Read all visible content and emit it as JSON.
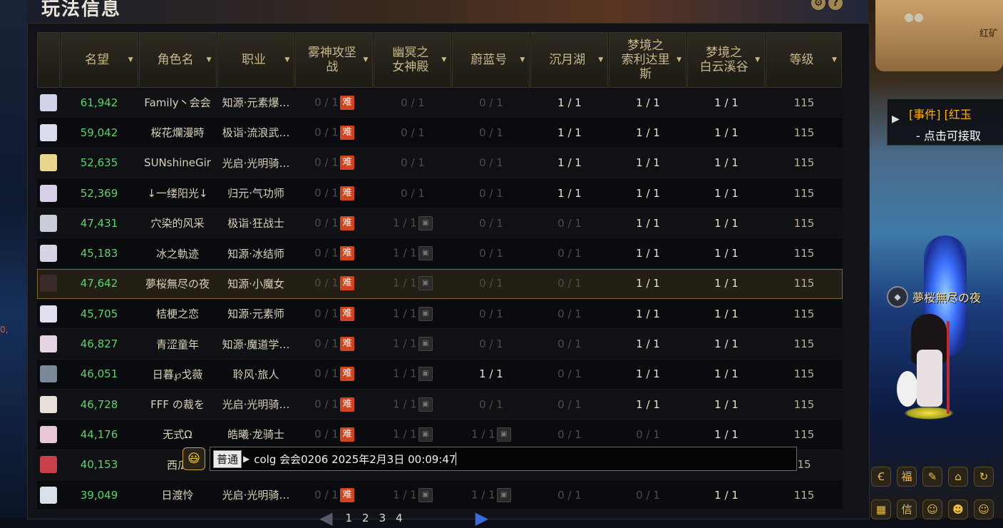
{
  "window": {
    "title": "玩法信息"
  },
  "top_icons": [
    {
      "name": "gear-icon",
      "glyph": "⚙"
    },
    {
      "name": "help-icon",
      "glyph": "?"
    }
  ],
  "columns": [
    {
      "label": "",
      "sortable": false
    },
    {
      "label": "名望",
      "sortable": true
    },
    {
      "label": "角色名",
      "sortable": true
    },
    {
      "label": "职业",
      "sortable": true
    },
    {
      "label": "雾神攻坚\n战",
      "sortable": true
    },
    {
      "label": "幽冥之\n女神殿",
      "sortable": true
    },
    {
      "label": "蔚蓝号",
      "sortable": true
    },
    {
      "label": "沉月湖",
      "sortable": true
    },
    {
      "label": "梦境之\n索利达里\n斯",
      "sortable": true
    },
    {
      "label": "梦境之\n白云溪谷",
      "sortable": true
    },
    {
      "label": "等级",
      "sortable": true
    }
  ],
  "rows": [
    {
      "portrait": "#cfd4e8",
      "fame": "61,942",
      "name": "Family丶会会",
      "class": "知源·元素爆…",
      "c4": "0 / 1",
      "c4_hard": true,
      "c5": "0 / 1",
      "c5_lock": false,
      "c6": "0 / 1",
      "c6_lock": false,
      "c7": "1 / 1",
      "c8": "1 / 1",
      "c9": "1 / 1",
      "level": "115"
    },
    {
      "portrait": "#dcdcf0",
      "fame": "59,042",
      "name": "桜花爛漫時",
      "class": "极诣·流浪武…",
      "c4": "0 / 1",
      "c4_hard": true,
      "c5": "0 / 1",
      "c5_lock": false,
      "c6": "0 / 1",
      "c6_lock": false,
      "c7": "1 / 1",
      "c8": "1 / 1",
      "c9": "1 / 1",
      "level": "115"
    },
    {
      "portrait": "#e8d48a",
      "fame": "52,635",
      "name": "SUNshineGir",
      "class": "光启·光明骑…",
      "c4": "0 / 1",
      "c4_hard": true,
      "c5": "0 / 1",
      "c5_lock": false,
      "c6": "0 / 1",
      "c6_lock": false,
      "c7": "1 / 1",
      "c8": "1 / 1",
      "c9": "1 / 1",
      "level": "115"
    },
    {
      "portrait": "#d8d0e8",
      "fame": "52,369",
      "name": "↓一缕阳光↓",
      "class": "归元·气功师",
      "c4": "0 / 1",
      "c4_hard": true,
      "c5": "0 / 1",
      "c5_lock": false,
      "c6": "0 / 1",
      "c6_lock": false,
      "c7": "1 / 1",
      "c8": "1 / 1",
      "c9": "1 / 1",
      "level": "115"
    },
    {
      "portrait": "#c8ccd8",
      "fame": "47,431",
      "name": "穴染的风采",
      "class": "极诣·狂战士",
      "c4": "0 / 1",
      "c4_hard": true,
      "c5": "1 / 1",
      "c5_lock": true,
      "c6": "0 / 1",
      "c6_lock": false,
      "c7": "0 / 1",
      "c8": "1 / 1",
      "c9": "1 / 1",
      "level": "115"
    },
    {
      "portrait": "#d4d4e4",
      "fame": "45,183",
      "name": "冰之軌迹",
      "class": "知源·冰结师",
      "c4": "0 / 1",
      "c4_hard": true,
      "c5": "1 / 1",
      "c5_lock": true,
      "c6": "0 / 1",
      "c6_lock": false,
      "c7": "0 / 1",
      "c8": "1 / 1",
      "c9": "1 / 1",
      "level": "115"
    },
    {
      "portrait": "#3a2a2a",
      "fame": "47,642",
      "name": "夢桜無尽の夜",
      "class": "知源·小魔女",
      "c4": "0 / 1",
      "c4_hard": true,
      "c5": "1 / 1",
      "c5_lock": true,
      "c6": "0 / 1",
      "c6_lock": false,
      "c7": "0 / 1",
      "c8": "1 / 1",
      "c9": "1 / 1",
      "level": "115",
      "selected": true
    },
    {
      "portrait": "#e0e0f0",
      "fame": "45,705",
      "name": "桔梗之恋",
      "class": "知源·元素师",
      "c4": "0 / 1",
      "c4_hard": true,
      "c5": "1 / 1",
      "c5_lock": true,
      "c6": "0 / 1",
      "c6_lock": false,
      "c7": "0 / 1",
      "c8": "1 / 1",
      "c9": "1 / 1",
      "level": "115"
    },
    {
      "portrait": "#e4d4e4",
      "fame": "46,827",
      "name": "青涩童年",
      "class": "知源·魔道学…",
      "c4": "0 / 1",
      "c4_hard": true,
      "c5": "1 / 1",
      "c5_lock": true,
      "c6": "0 / 1",
      "c6_lock": false,
      "c7": "0 / 1",
      "c8": "1 / 1",
      "c9": "1 / 1",
      "level": "115"
    },
    {
      "portrait": "#7a8898",
      "fame": "46,051",
      "name": "日暮℘戈薇",
      "class": "聆风·旅人",
      "c4": "0 / 1",
      "c4_hard": true,
      "c5": "1 / 1",
      "c5_lock": true,
      "c6": "1 / 1",
      "c6_lock": false,
      "c7": "0 / 1",
      "c8": "1 / 1",
      "c9": "1 / 1",
      "level": "115"
    },
    {
      "portrait": "#e8e0d8",
      "fame": "46,728",
      "name": "FFF の裁を",
      "class": "光启·光明骑…",
      "c4": "0 / 1",
      "c4_hard": true,
      "c5": "1 / 1",
      "c5_lock": true,
      "c6": "0 / 1",
      "c6_lock": false,
      "c7": "0 / 1",
      "c8": "1 / 1",
      "c9": "1 / 1",
      "level": "115"
    },
    {
      "portrait": "#e8c8d8",
      "fame": "44,176",
      "name": "无式Ω",
      "class": "皓曦·龙骑士",
      "c4": "0 / 1",
      "c4_hard": true,
      "c5": "1 / 1",
      "c5_lock": true,
      "c6": "1 / 1",
      "c6_lock": true,
      "c7": "0 / 1",
      "c8": "0 / 1",
      "c9": "1 / 1",
      "level": "115"
    },
    {
      "portrait": "#c84048",
      "fame": "40,153",
      "name": "西瓜",
      "class": "",
      "c4": "",
      "c4_hard": false,
      "c5": "",
      "c5_lock": false,
      "c6": "",
      "c6_lock": false,
      "c7": "",
      "c8": "",
      "c9": "",
      "level": "15"
    },
    {
      "portrait": "#d8e0e8",
      "fame": "39,049",
      "name": "日渡怜",
      "class": "光启·光明骑…",
      "c4": "0 / 1",
      "c4_hard": true,
      "c5": "1 / 1",
      "c5_lock": true,
      "c6": "1 / 1",
      "c6_lock": true,
      "c7": "0 / 1",
      "c8": "0 / 1",
      "c9": "1 / 1",
      "level": "115"
    }
  ],
  "badges": {
    "hard": "难",
    "lock": "🔒"
  },
  "chat": {
    "emote": "😃",
    "channel": "普通",
    "message": "colg 会会0206  2025年2月3日 00:09:47"
  },
  "pager": {
    "pages": [
      "1",
      "2",
      "3",
      "4"
    ]
  },
  "scene": {
    "npc_name": "红矿",
    "event_line1": "[事件] [红玉",
    "event_line2": "- 点击可接取",
    "character_name": "夢桜無尽の夜",
    "hud_icons": [
      "coin-icon",
      "fortune-icon",
      "quest-icon",
      "house-icon",
      "special-icon"
    ]
  }
}
